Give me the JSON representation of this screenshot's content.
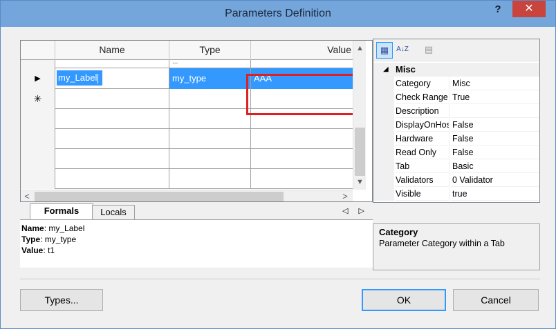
{
  "window": {
    "title": "Parameters Definition",
    "help": "?",
    "close": "✕"
  },
  "grid": {
    "columns": {
      "name": "Name",
      "type": "Type",
      "value": "Value"
    },
    "partial_top": "...",
    "rows": [
      {
        "marker": "▶",
        "name": "my_Label",
        "type": "my_type",
        "value": "AAA"
      },
      {
        "marker": "✳",
        "name": "",
        "type": "",
        "value": ""
      }
    ],
    "scroll": {
      "up": "▲",
      "down": "▼",
      "left": "<",
      "right": ">"
    }
  },
  "tabs": {
    "formals": "Formals",
    "locals": "Locals",
    "arrows": "◁ ▷"
  },
  "details": {
    "name_label": "Name",
    "name_value": ": my_Label",
    "type_label": "Type",
    "type_value": ": my_type",
    "value_label": "Value",
    "value_value": ": t1"
  },
  "property_grid": {
    "toolbar": {
      "categorized": "▦",
      "alphabetical": "A↓Z",
      "pages": "▤"
    },
    "category": {
      "toggle": "◢",
      "name": "Misc"
    },
    "properties": [
      {
        "name": "Category",
        "value": "Misc"
      },
      {
        "name": "Check Range",
        "value": "True"
      },
      {
        "name": "Description",
        "value": ""
      },
      {
        "name": "DisplayOnHost",
        "value": "False"
      },
      {
        "name": "Hardware",
        "value": "False"
      },
      {
        "name": "Read Only",
        "value": "False"
      },
      {
        "name": "Tab",
        "value": "Basic"
      },
      {
        "name": "Validators",
        "value": "0 Validator"
      },
      {
        "name": "Visible",
        "value": "true"
      }
    ]
  },
  "description": {
    "title": "Category",
    "text": "Parameter Category within a Tab"
  },
  "buttons": {
    "types": "Types...",
    "ok": "OK",
    "cancel": "Cancel"
  },
  "colors": {
    "selection": "#3399ff",
    "highlight_box": "#e02020",
    "titlebar": "#74a5db",
    "close": "#c8443d"
  }
}
